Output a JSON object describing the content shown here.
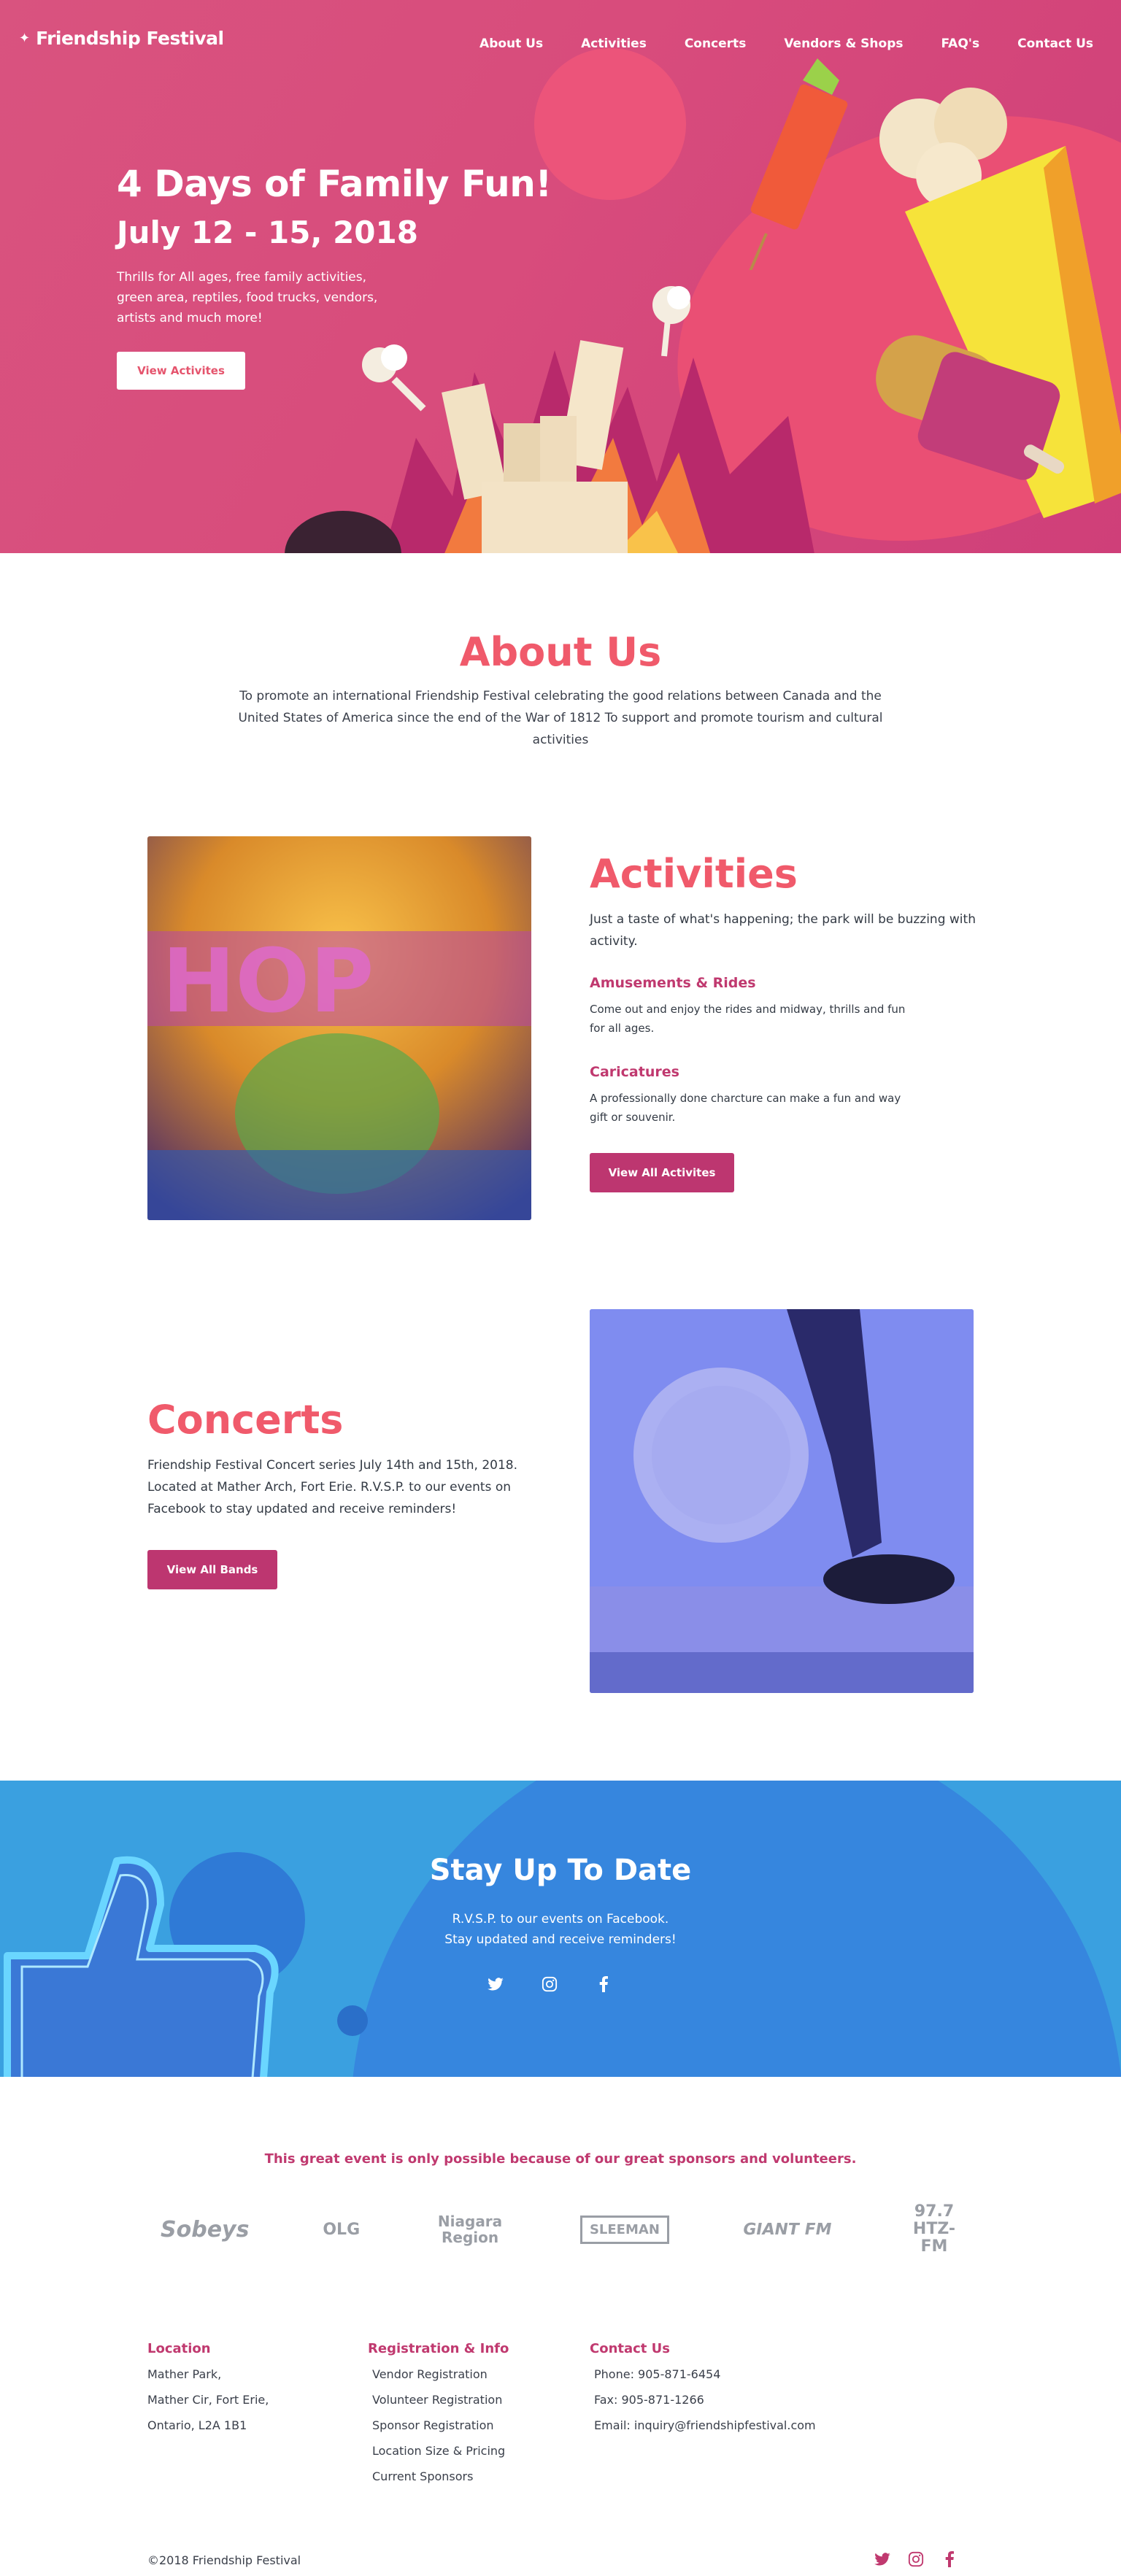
{
  "header": {
    "logo_text": "Friendship Festival",
    "nav": [
      "About Us",
      "Activities",
      "Concerts",
      "Vendors & Shops",
      "FAQ's",
      "Contact Us"
    ]
  },
  "hero": {
    "title": "4 Days of Family Fun!",
    "date": "July 12 - 15, 2018",
    "description": "Thrills for All ages, free family activities, green area, reptiles, food trucks, vendors, artists and much more!",
    "button": "View Activites"
  },
  "about": {
    "title": "About Us",
    "text": "To promote an international Friendship Festival celebrating the good relations between Canada and the United States of America since the end of the War of 1812 To support and promote tourism and cultural activities"
  },
  "activities": {
    "title": "Activities",
    "intro": "Just a taste of what's happening; the park will be buzzing with activity.",
    "items": [
      {
        "title": "Amusements & Rides",
        "text": "Come out and enjoy the rides and midway, thrills and fun for all ages."
      },
      {
        "title": "Caricatures",
        "text": "A professionally done charcture can make a fun and way gift or souvenir."
      }
    ],
    "button": "View All Activites"
  },
  "concerts": {
    "title": "Concerts",
    "text": "Friendship Festival Concert series July 14th and 15th, 2018. Located at Mather Arch, Fort Erie. R.V.S.P. to our events on Facebook to stay updated and receive reminders!",
    "button": "View All Bands"
  },
  "stay": {
    "title": "Stay Up To Date",
    "line1": "R.V.S.P. to our events on Facebook.",
    "line2": "Stay updated and receive reminders!",
    "icons": [
      "twitter-icon",
      "instagram-icon",
      "facebook-icon"
    ]
  },
  "sponsors": {
    "line": "This great event is only possible because of our great sponsors and volunteers.",
    "logos": [
      "Sobeys",
      "OLG",
      "Niagara Region",
      "SLEEMAN",
      "GIANT FM",
      "97.7 HTZ-FM"
    ]
  },
  "footer": {
    "location": {
      "title": "Location",
      "lines": [
        "Mather Park,",
        "Mather Cir, Fort Erie,",
        "Ontario, L2A 1B1"
      ]
    },
    "registration": {
      "title": "Registration & Info",
      "links": [
        "Vendor Registration",
        "Volunteer Registration",
        "Sponsor Registration",
        "Location Size & Pricing",
        "Current Sponsors"
      ]
    },
    "contact": {
      "title": "Contact Us",
      "lines": [
        "Phone: 905-871-6454",
        "Fax: 905-871-1266",
        "Email: inquiry@friendshipfestival.com"
      ]
    },
    "copyright": "©2018 Friendship Festival"
  },
  "colors": {
    "hero_bg": "#d84c7c",
    "accent": "#f05a6b",
    "magenta": "#bd3670",
    "blue": "#3aa0e0"
  }
}
